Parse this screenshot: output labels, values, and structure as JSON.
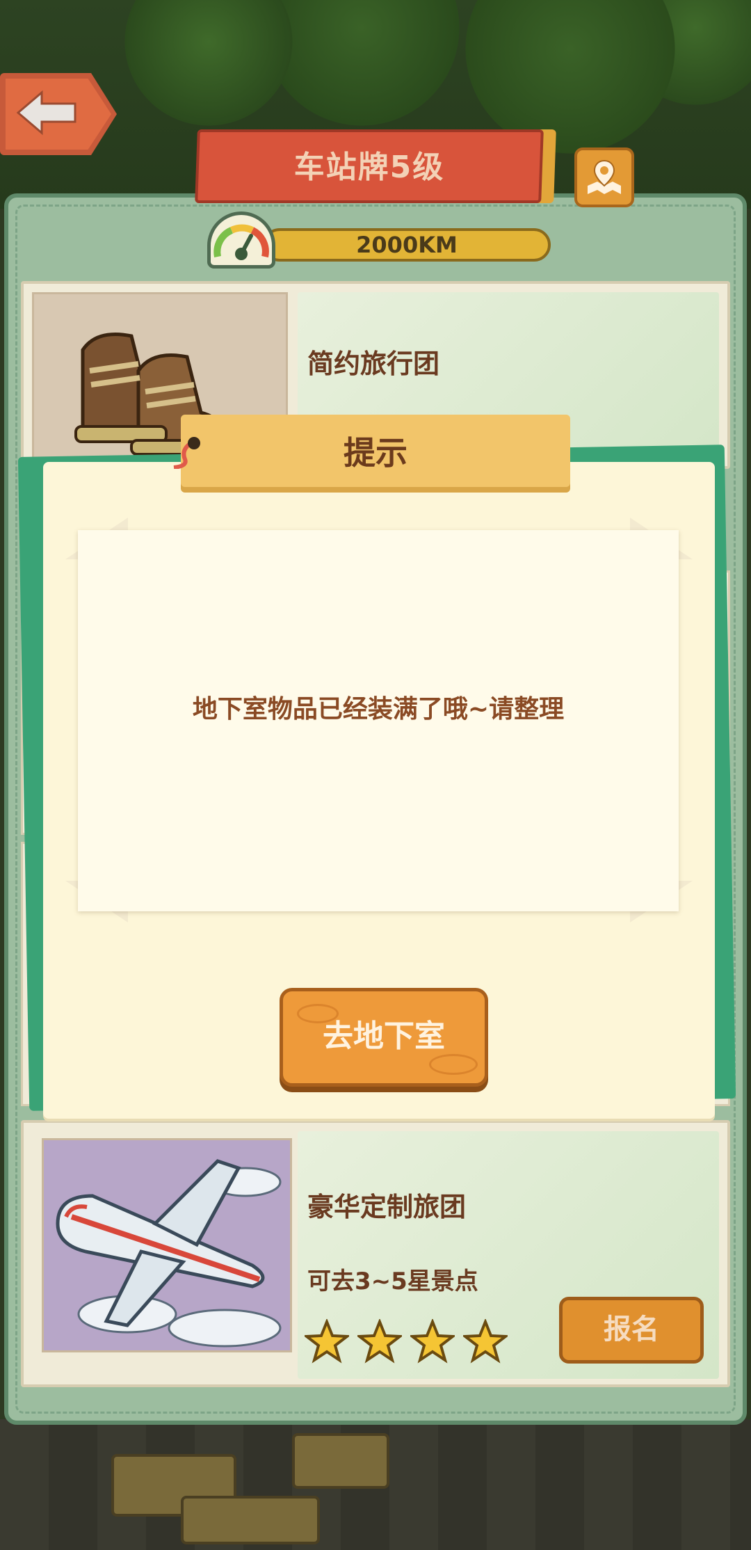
{
  "header": {
    "title": "车站牌5级",
    "distance": "2000KM"
  },
  "cards": [
    {
      "title": "简约旅行团",
      "thumbnail": "boots"
    },
    {
      "title": "豪华定制旅团",
      "description": "可去3~5星景点",
      "stars": 4,
      "thumbnail": "airplane",
      "signup_label": "报名"
    }
  ],
  "modal": {
    "tag_label": "提示",
    "message": "地下室物品已经装满了哦~请整理",
    "button_label": "去地下室"
  },
  "colors": {
    "panel_green": "#9cbd9f",
    "title_red": "#d8543b",
    "button_orange": "#ee9a3a",
    "text_brown": "#6a3a20"
  }
}
